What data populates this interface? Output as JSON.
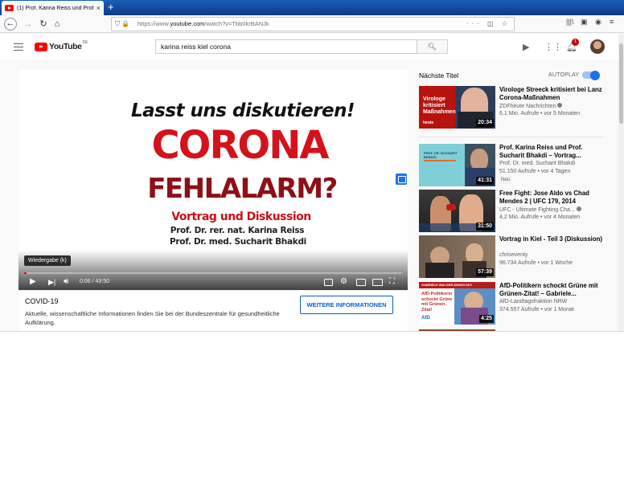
{
  "browser": {
    "tab_title": "(1) Prof. Karina Reiss und Prof.",
    "tab_close": "×",
    "new_tab": "+",
    "url_prefix": "https://www.",
    "url_host": "youtube.com",
    "url_path": "/watch?v=Tbb0krBANJk",
    "url_menu": "···"
  },
  "youtube": {
    "logo_word": "YouTube",
    "logo_country": "DE",
    "search_query": "karina reiss kiel corona",
    "notification_count": "1"
  },
  "player": {
    "frame_line1": "Lasst uns diskutieren!",
    "frame_line2": "CORONA",
    "frame_line3": "FEHLALARM?",
    "frame_line4": "Vortrag und Diskussion",
    "frame_line5": "Prof. Dr. rer. nat. Karina Reiss",
    "frame_line6": "Prof. Dr. med. Sucharit Bhakdi",
    "tooltip": "Wiedergabe (k)",
    "time_current": "0:06",
    "time_separator": " / ",
    "time_total": "43:50",
    "progress_fraction": 0.0023
  },
  "info_panel": {
    "title": "COVID-19",
    "description": "Aktuelle, wissenschaftliche Informationen finden Sie bei der Bundeszentrale für gesundheitliche Aufklärung.",
    "button_label": "WEITERE INFORMATIONEN"
  },
  "sidebar": {
    "up_next_label": "Nächste Titel",
    "autoplay_label": "AUTOPLAY",
    "videos": [
      {
        "title": "Virologe Streeck kritisiert bei Lanz Corona-Maßnahmen",
        "channel": "ZDFheute Nachrichten",
        "meta": "6,1 Mio. Aufrufe • vor 5 Monaten",
        "duration": "20:34",
        "thumb_text": "Virologe kritisiert Maßnahmen",
        "thumb_brand": "heute"
      },
      {
        "title": "Prof. Karina Reiss und Prof. Sucharit Bhakdi – Vortrag...",
        "channel": "Prof. Dr. med. Sucharit Bhakdi",
        "meta": "51.150 Aufrufe • vor 4 Tagen",
        "badge": "Neu",
        "duration": "41:31",
        "thumb_text": "PROF. DR. SUCHARIT BHAKDI"
      },
      {
        "title": "Free Fight: Jose Aldo vs Chad Mendes 2 | UFC 179, 2014",
        "channel": "UFC - Ultimate Fighting Cha...",
        "meta": "4,2 Mio. Aufrufe • vor 4 Monaten",
        "duration": "31:50"
      },
      {
        "title": "Vortrag in Kiel - Teil 3 (Diskussion)",
        "channel": "chriseventy",
        "meta": "96.734 Aufrufe • vor 1 Woche",
        "duration": "57:39"
      },
      {
        "title": "AfD-Politikern schockt Grüne mit Grünen-Zitat! – Gabriele...",
        "channel": "AfD-Landtagsfraktion NRW",
        "meta": "374.557 Aufrufe • vor 1 Monat",
        "duration": "4:25",
        "thumb_text": "AfD-Politikerin schockt Grüne mit Grünen-Zitat!",
        "thumb_brand": "AfD",
        "thumb_header": "GABRIELE WALGER-DEMOLSKY"
      }
    ]
  },
  "colors": {
    "brand_red": "#ff0000",
    "link_blue": "#065fd4",
    "toggle_blue": "#1a73e8"
  }
}
